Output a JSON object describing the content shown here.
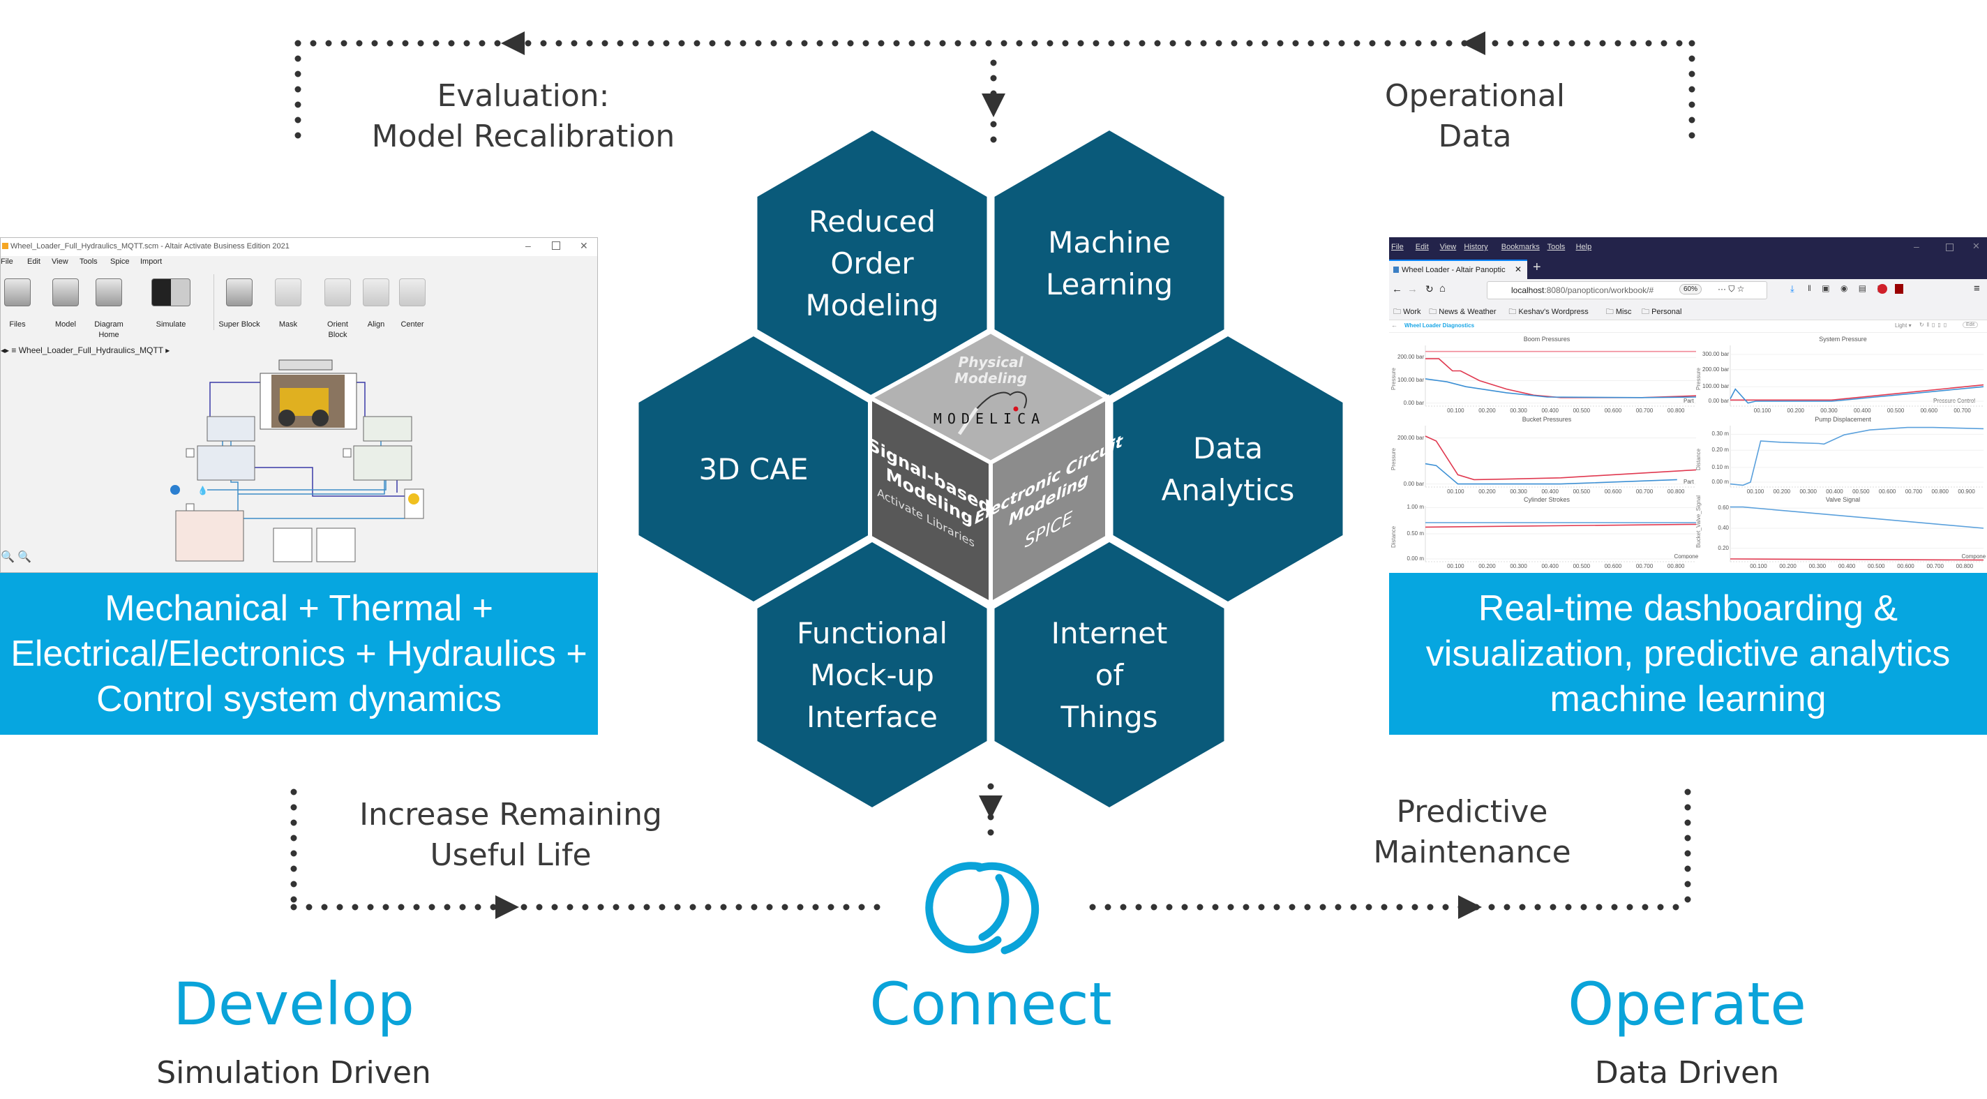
{
  "top_loop": {
    "left_label": [
      "Evaluation:",
      "Model Recalibration"
    ],
    "right_label": [
      "Operational",
      "Data"
    ]
  },
  "bottom_loop": {
    "left_label": [
      "Increase Remaining",
      "Useful Life"
    ],
    "right_label": [
      "Predictive",
      "Maintenance"
    ]
  },
  "hexagons": [
    {
      "lines": [
        "Reduced",
        "Order",
        "Modeling"
      ]
    },
    {
      "lines": [
        "Machine",
        "Learning"
      ]
    },
    {
      "lines": [
        "3D CAE"
      ]
    },
    {
      "lines": [
        "Data",
        "Analytics"
      ]
    },
    {
      "lines": [
        "Functional",
        "Mock-up",
        "Interface"
      ]
    },
    {
      "lines": [
        "Internet",
        "of",
        "Things"
      ]
    }
  ],
  "cube": {
    "top": [
      "Physical",
      "Modeling"
    ],
    "logo": "MODELICA",
    "left": [
      "Signal-based",
      "Modeling"
    ],
    "left_sub": "Activate Libraries",
    "right": [
      "Electronic Circuit",
      "Modeling"
    ],
    "right_sub": "SPICE"
  },
  "phases": [
    {
      "title": "Develop",
      "subtitle": "Simulation Driven"
    },
    {
      "title": "Connect",
      "subtitle": ""
    },
    {
      "title": "Operate",
      "subtitle": "Data Driven"
    }
  ],
  "left_panel": {
    "window_title": "Wheel_Loader_Full_Hydraulics_MQTT.scm - Altair Activate Business Edition 2021",
    "menu": [
      "File",
      "Edit",
      "View",
      "Tools",
      "Spice",
      "Import"
    ],
    "toolbar": [
      {
        "label": "Files",
        "icon": "files-icon"
      },
      {
        "label": "Model",
        "icon": "model-icon"
      },
      {
        "label": "Diagram",
        "label2": "Home",
        "icon": "diagram-icon"
      },
      {
        "label": "Simulate",
        "icon": "simulate-icon"
      },
      {
        "label": "Super Block",
        "icon": "super-block-icon"
      },
      {
        "label": "Mask",
        "icon": "mask-icon"
      },
      {
        "label": "Orient",
        "label2": "Block",
        "icon": "orient-icon"
      },
      {
        "label": "Align",
        "icon": "align-icon"
      },
      {
        "label": "Center",
        "icon": "center-icon"
      }
    ],
    "breadcrumb": "Wheel_Loader_Full_Hydraulics_MQTT",
    "banner": [
      "Mechanical + Thermal +",
      "Electrical/Electronics + Hydraulics +",
      "Control system dynamics"
    ]
  },
  "right_panel": {
    "menu": [
      "File",
      "Edit",
      "View",
      "History",
      "Bookmarks",
      "Tools",
      "Help"
    ],
    "tab_title": "Wheel Loader - Altair Panoptic",
    "url_host": "localhost",
    "url_rest": ":8080/panopticon/workbook/#",
    "zoom": "60%",
    "bookmarks": [
      "Work",
      "News & Weather",
      "Keshav's Wordpress",
      "Misc",
      "Personal"
    ],
    "app_title": "Wheel Loader Diagnostics",
    "app_controls": [
      "Light ▾",
      "Edit"
    ],
    "charts": [
      {
        "title": "Boom Pressures",
        "ylabel": "Pressure",
        "yticks": [
          "200.00 bar",
          "100.00 bar",
          "0.00 bar"
        ],
        "xticks": [
          "00.100",
          "00.200",
          "00.300",
          "00.400",
          "00.500",
          "00.600",
          "00.700",
          "00.800"
        ],
        "legend": "Part"
      },
      {
        "title": "System Pressure",
        "ylabel": "Pressure",
        "yticks": [
          "300.00 bar",
          "200.00 bar",
          "100.00 bar",
          "0.00 bar"
        ],
        "xticks": [
          "00.100",
          "00.200",
          "00.300",
          "00.400",
          "00.500",
          "00.600",
          "00.700"
        ],
        "legend": "Pressure Control"
      },
      {
        "title": "Bucket Pressures",
        "ylabel": "Pressure",
        "yticks": [
          "200.00 bar",
          "0.00 bar"
        ],
        "xticks": [
          "00.100",
          "00.200",
          "00.300",
          "00.400",
          "00.500",
          "00.600",
          "00.700",
          "00.800"
        ],
        "legend": "Part"
      },
      {
        "title": "Pump Displacement",
        "ylabel": "Distance",
        "yticks": [
          "0.30 m",
          "0.20 m",
          "0.10 m",
          "0.00 m"
        ],
        "xticks": [
          "00.100",
          "00.200",
          "00.300",
          "00.400",
          "00.500",
          "00.600",
          "00.700",
          "00.800",
          "00.900"
        ],
        "legend": ""
      },
      {
        "title": "Cylinder Strokes",
        "ylabel": "Distance",
        "yticks": [
          "1.00 m",
          "0.50 m",
          "0.00 m"
        ],
        "xticks": [
          "00.100",
          "00.200",
          "00.300",
          "00.400",
          "00.500",
          "00.600",
          "00.700",
          "00.800"
        ],
        "legend": "Compone"
      },
      {
        "title": "Valve Signal",
        "ylabel": "Bucket_Valve_Signal",
        "yticks": [
          "0.60",
          "0.40",
          "0.20"
        ],
        "xticks": [
          "00.100",
          "00.200",
          "00.300",
          "00.400",
          "00.500",
          "00.600",
          "00.700",
          "00.800"
        ],
        "legend": "Compone"
      }
    ],
    "banner": [
      "Real-time dashboarding &",
      "visualization, predictive analytics",
      "machine learning"
    ]
  },
  "colors": {
    "hex": "#0a5a7a",
    "accent": "#0aa3d9",
    "banner": "#06a6e0",
    "dots": "#333333",
    "browser_chrome": "#23234a",
    "series_red": "#e0384f",
    "series_blue": "#3b8fd4"
  }
}
